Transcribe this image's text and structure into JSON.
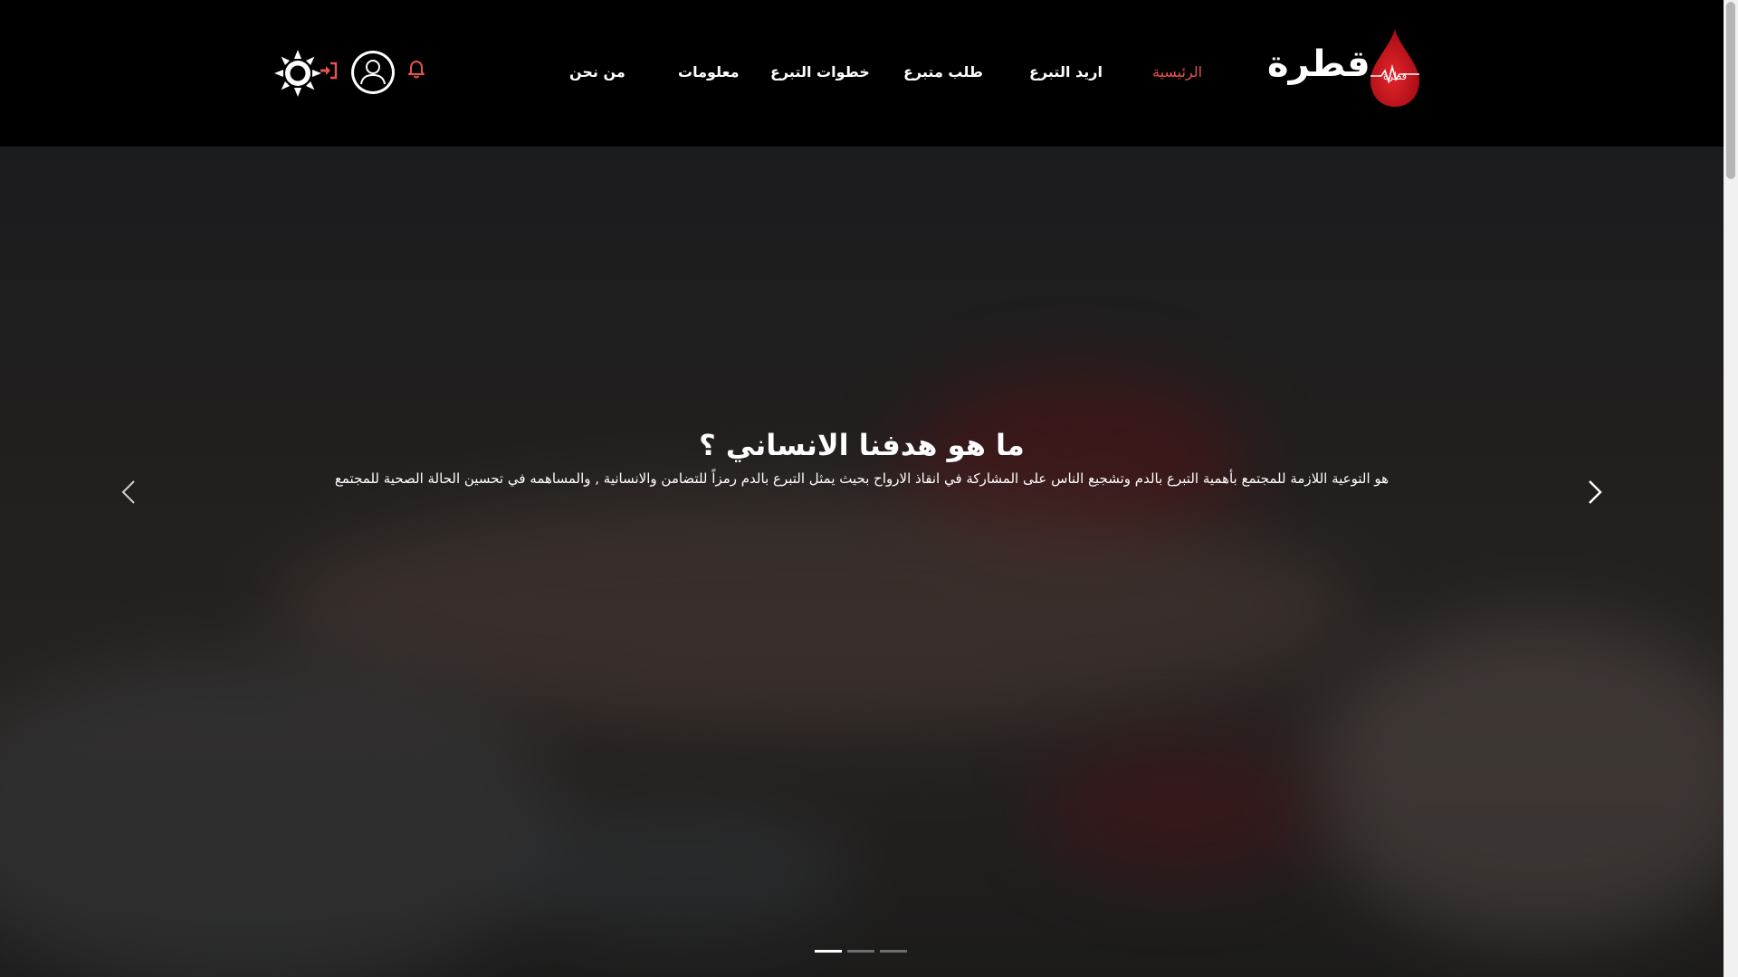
{
  "top_progress": {
    "fraction": 0.17
  },
  "header": {
    "logo_text": "قطرة",
    "logo_drop_text": "قطرة",
    "nav": [
      {
        "label": "الرئيسية",
        "active": true
      },
      {
        "label": "اريد التبرع",
        "active": false
      },
      {
        "label": "طلب متبرع",
        "active": false
      },
      {
        "label": "خطوات التبرع",
        "active": false
      },
      {
        "label": "معلومات",
        "active": false
      },
      {
        "label": "من نحن",
        "active": false
      }
    ],
    "icons": [
      "bell-icon",
      "user-avatar-icon",
      "login-icon",
      "sun-theme-icon"
    ]
  },
  "hero": {
    "title": "ما هو هدفنا الانساني ؟",
    "text": "هو التوعية اللازمة للمجتمع بأهمية التبرع بالدم وتشجيع الناس على المشاركة في انقاذ الارواح بحيث يمثل التبرع بالدم رمزاً للتضامن والانسانية , والمساهمه في تحسين الحالة الصحية للمجتمع",
    "slides": 3,
    "active_slide": 1
  },
  "colors": {
    "accent": "#e8534f",
    "drop": "#d4121a",
    "background": "#000000"
  }
}
